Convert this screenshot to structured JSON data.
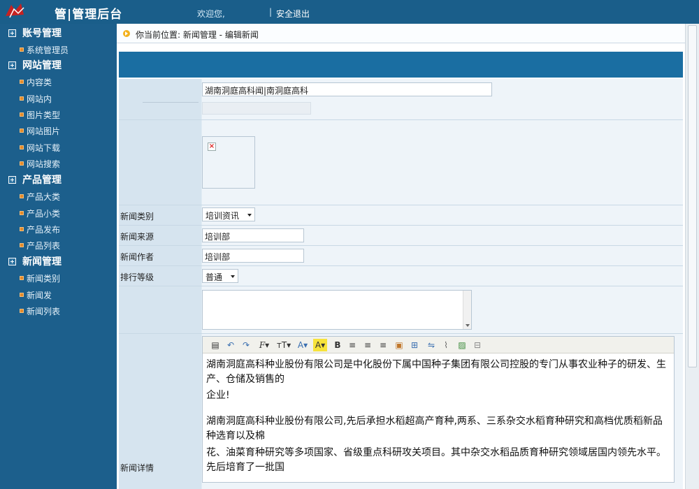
{
  "header": {
    "logo_text": "管|管理后台",
    "welcome": "欢迎您,",
    "separator": "|",
    "logout": "安全退出"
  },
  "sidebar": {
    "groups": [
      {
        "label": "账号管理",
        "items": [
          "系统管理员"
        ]
      },
      {
        "label": "网站管理",
        "items": [
          "内容类",
          "网站内",
          "图片类型",
          "网站图片",
          "网站下载",
          "网站搜索"
        ]
      },
      {
        "label": "产品管理",
        "items": [
          "产品大类",
          "产品小类",
          "产品发布",
          "产品列表"
        ]
      },
      {
        "label": "新闻管理",
        "items": [
          "新闻类别",
          "新闻发",
          "新闻列表"
        ]
      }
    ]
  },
  "breadcrumb": {
    "text": "你当前位置: 新闻管理 - 编辑新闻"
  },
  "form": {
    "title_value": "湖南洞庭高科闻|南洞庭高科",
    "category_label": "新闻类别",
    "category_value": "培训资讯",
    "source_label": "新闻来源",
    "source_value": "培训部",
    "author_label": "新闻作者",
    "author_value": "培训部",
    "rank_label": "排行等级",
    "rank_value": "普通",
    "detail_label": "新闻详情"
  },
  "editor": {
    "toolbar": [
      "source-icon",
      "undo-icon",
      "redo-icon",
      "font-family-icon",
      "font-size-icon",
      "font-color-icon",
      "highlight-icon",
      "bold-icon",
      "align-left-icon",
      "align-center-icon",
      "align-right-icon",
      "image-icon",
      "table-icon",
      "flash-icon",
      "attachment-icon",
      "picture-icon",
      "pagebreak-icon"
    ],
    "paragraphs": [
      "湖南洞庭高科种业股份有限公司是中化股份下属中国种子集团有限公司控股的专门从事农业种子的研发、生产、仓储及销售的",
      "企业!",
      "",
      "湖南洞庭高科种业股份有限公司,先后承担水稻超高产育种,两系、三系杂交水稻育种研究和高档优质稻新品种选育以及棉",
      "花、油菜育种研究等多项国家、省级重点科研攻关项目。其中杂交水稻品质育种研究领域居国内领先水平。先后培育了一批国"
    ]
  },
  "colors": {
    "topbar": "#1a5e8a",
    "sidebar": "#1c5f8c",
    "form_header": "#1a6ea2",
    "form_bg": "#e1ecf4",
    "label_bg": "#d6e4ef",
    "bullet": "#e58a2a"
  }
}
